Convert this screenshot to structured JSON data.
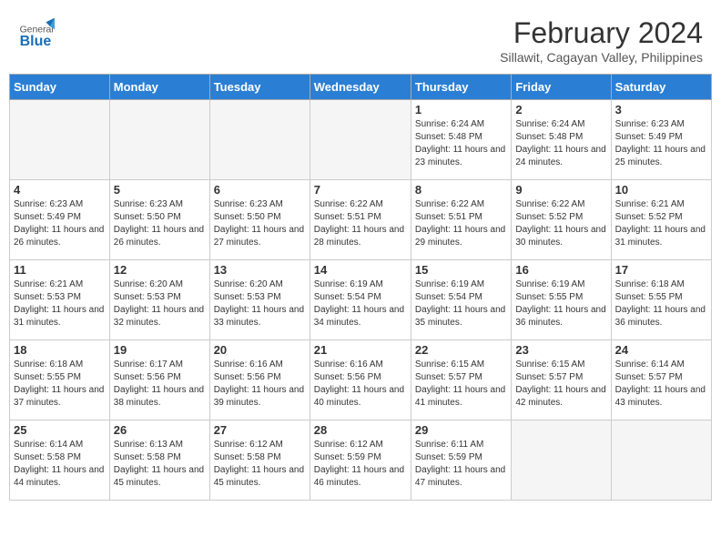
{
  "header": {
    "logo_general": "General",
    "logo_blue": "Blue",
    "month_year": "February 2024",
    "location": "Sillawit, Cagayan Valley, Philippines"
  },
  "weekdays": [
    "Sunday",
    "Monday",
    "Tuesday",
    "Wednesday",
    "Thursday",
    "Friday",
    "Saturday"
  ],
  "weeks": [
    [
      {
        "day": "",
        "info": ""
      },
      {
        "day": "",
        "info": ""
      },
      {
        "day": "",
        "info": ""
      },
      {
        "day": "",
        "info": ""
      },
      {
        "day": "1",
        "info": "Sunrise: 6:24 AM\nSunset: 5:48 PM\nDaylight: 11 hours and 23 minutes."
      },
      {
        "day": "2",
        "info": "Sunrise: 6:24 AM\nSunset: 5:48 PM\nDaylight: 11 hours and 24 minutes."
      },
      {
        "day": "3",
        "info": "Sunrise: 6:23 AM\nSunset: 5:49 PM\nDaylight: 11 hours and 25 minutes."
      }
    ],
    [
      {
        "day": "4",
        "info": "Sunrise: 6:23 AM\nSunset: 5:49 PM\nDaylight: 11 hours and 26 minutes."
      },
      {
        "day": "5",
        "info": "Sunrise: 6:23 AM\nSunset: 5:50 PM\nDaylight: 11 hours and 26 minutes."
      },
      {
        "day": "6",
        "info": "Sunrise: 6:23 AM\nSunset: 5:50 PM\nDaylight: 11 hours and 27 minutes."
      },
      {
        "day": "7",
        "info": "Sunrise: 6:22 AM\nSunset: 5:51 PM\nDaylight: 11 hours and 28 minutes."
      },
      {
        "day": "8",
        "info": "Sunrise: 6:22 AM\nSunset: 5:51 PM\nDaylight: 11 hours and 29 minutes."
      },
      {
        "day": "9",
        "info": "Sunrise: 6:22 AM\nSunset: 5:52 PM\nDaylight: 11 hours and 30 minutes."
      },
      {
        "day": "10",
        "info": "Sunrise: 6:21 AM\nSunset: 5:52 PM\nDaylight: 11 hours and 31 minutes."
      }
    ],
    [
      {
        "day": "11",
        "info": "Sunrise: 6:21 AM\nSunset: 5:53 PM\nDaylight: 11 hours and 31 minutes."
      },
      {
        "day": "12",
        "info": "Sunrise: 6:20 AM\nSunset: 5:53 PM\nDaylight: 11 hours and 32 minutes."
      },
      {
        "day": "13",
        "info": "Sunrise: 6:20 AM\nSunset: 5:53 PM\nDaylight: 11 hours and 33 minutes."
      },
      {
        "day": "14",
        "info": "Sunrise: 6:19 AM\nSunset: 5:54 PM\nDaylight: 11 hours and 34 minutes."
      },
      {
        "day": "15",
        "info": "Sunrise: 6:19 AM\nSunset: 5:54 PM\nDaylight: 11 hours and 35 minutes."
      },
      {
        "day": "16",
        "info": "Sunrise: 6:19 AM\nSunset: 5:55 PM\nDaylight: 11 hours and 36 minutes."
      },
      {
        "day": "17",
        "info": "Sunrise: 6:18 AM\nSunset: 5:55 PM\nDaylight: 11 hours and 36 minutes."
      }
    ],
    [
      {
        "day": "18",
        "info": "Sunrise: 6:18 AM\nSunset: 5:55 PM\nDaylight: 11 hours and 37 minutes."
      },
      {
        "day": "19",
        "info": "Sunrise: 6:17 AM\nSunset: 5:56 PM\nDaylight: 11 hours and 38 minutes."
      },
      {
        "day": "20",
        "info": "Sunrise: 6:16 AM\nSunset: 5:56 PM\nDaylight: 11 hours and 39 minutes."
      },
      {
        "day": "21",
        "info": "Sunrise: 6:16 AM\nSunset: 5:56 PM\nDaylight: 11 hours and 40 minutes."
      },
      {
        "day": "22",
        "info": "Sunrise: 6:15 AM\nSunset: 5:57 PM\nDaylight: 11 hours and 41 minutes."
      },
      {
        "day": "23",
        "info": "Sunrise: 6:15 AM\nSunset: 5:57 PM\nDaylight: 11 hours and 42 minutes."
      },
      {
        "day": "24",
        "info": "Sunrise: 6:14 AM\nSunset: 5:57 PM\nDaylight: 11 hours and 43 minutes."
      }
    ],
    [
      {
        "day": "25",
        "info": "Sunrise: 6:14 AM\nSunset: 5:58 PM\nDaylight: 11 hours and 44 minutes."
      },
      {
        "day": "26",
        "info": "Sunrise: 6:13 AM\nSunset: 5:58 PM\nDaylight: 11 hours and 45 minutes."
      },
      {
        "day": "27",
        "info": "Sunrise: 6:12 AM\nSunset: 5:58 PM\nDaylight: 11 hours and 45 minutes."
      },
      {
        "day": "28",
        "info": "Sunrise: 6:12 AM\nSunset: 5:59 PM\nDaylight: 11 hours and 46 minutes."
      },
      {
        "day": "29",
        "info": "Sunrise: 6:11 AM\nSunset: 5:59 PM\nDaylight: 11 hours and 47 minutes."
      },
      {
        "day": "",
        "info": ""
      },
      {
        "day": "",
        "info": ""
      }
    ]
  ]
}
